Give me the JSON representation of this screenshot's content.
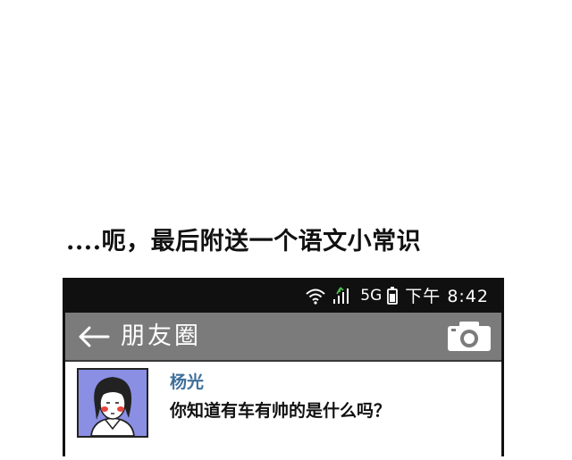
{
  "caption": "....呃，最后附送一个语文小常识",
  "status_bar": {
    "network_label": "5G",
    "clock": "下午 8:42"
  },
  "app_bar": {
    "title": "朋友圈",
    "back_icon": "arrow-left-icon",
    "camera_icon": "camera-icon"
  },
  "post": {
    "author": "杨光",
    "text": "你知道有车有帅的是什么吗？",
    "avatar_background": "#8a8fe4"
  },
  "colors": {
    "status_bar": "#101010",
    "app_bar": "#7b7b7b",
    "author_name": "#3f6f9a"
  }
}
